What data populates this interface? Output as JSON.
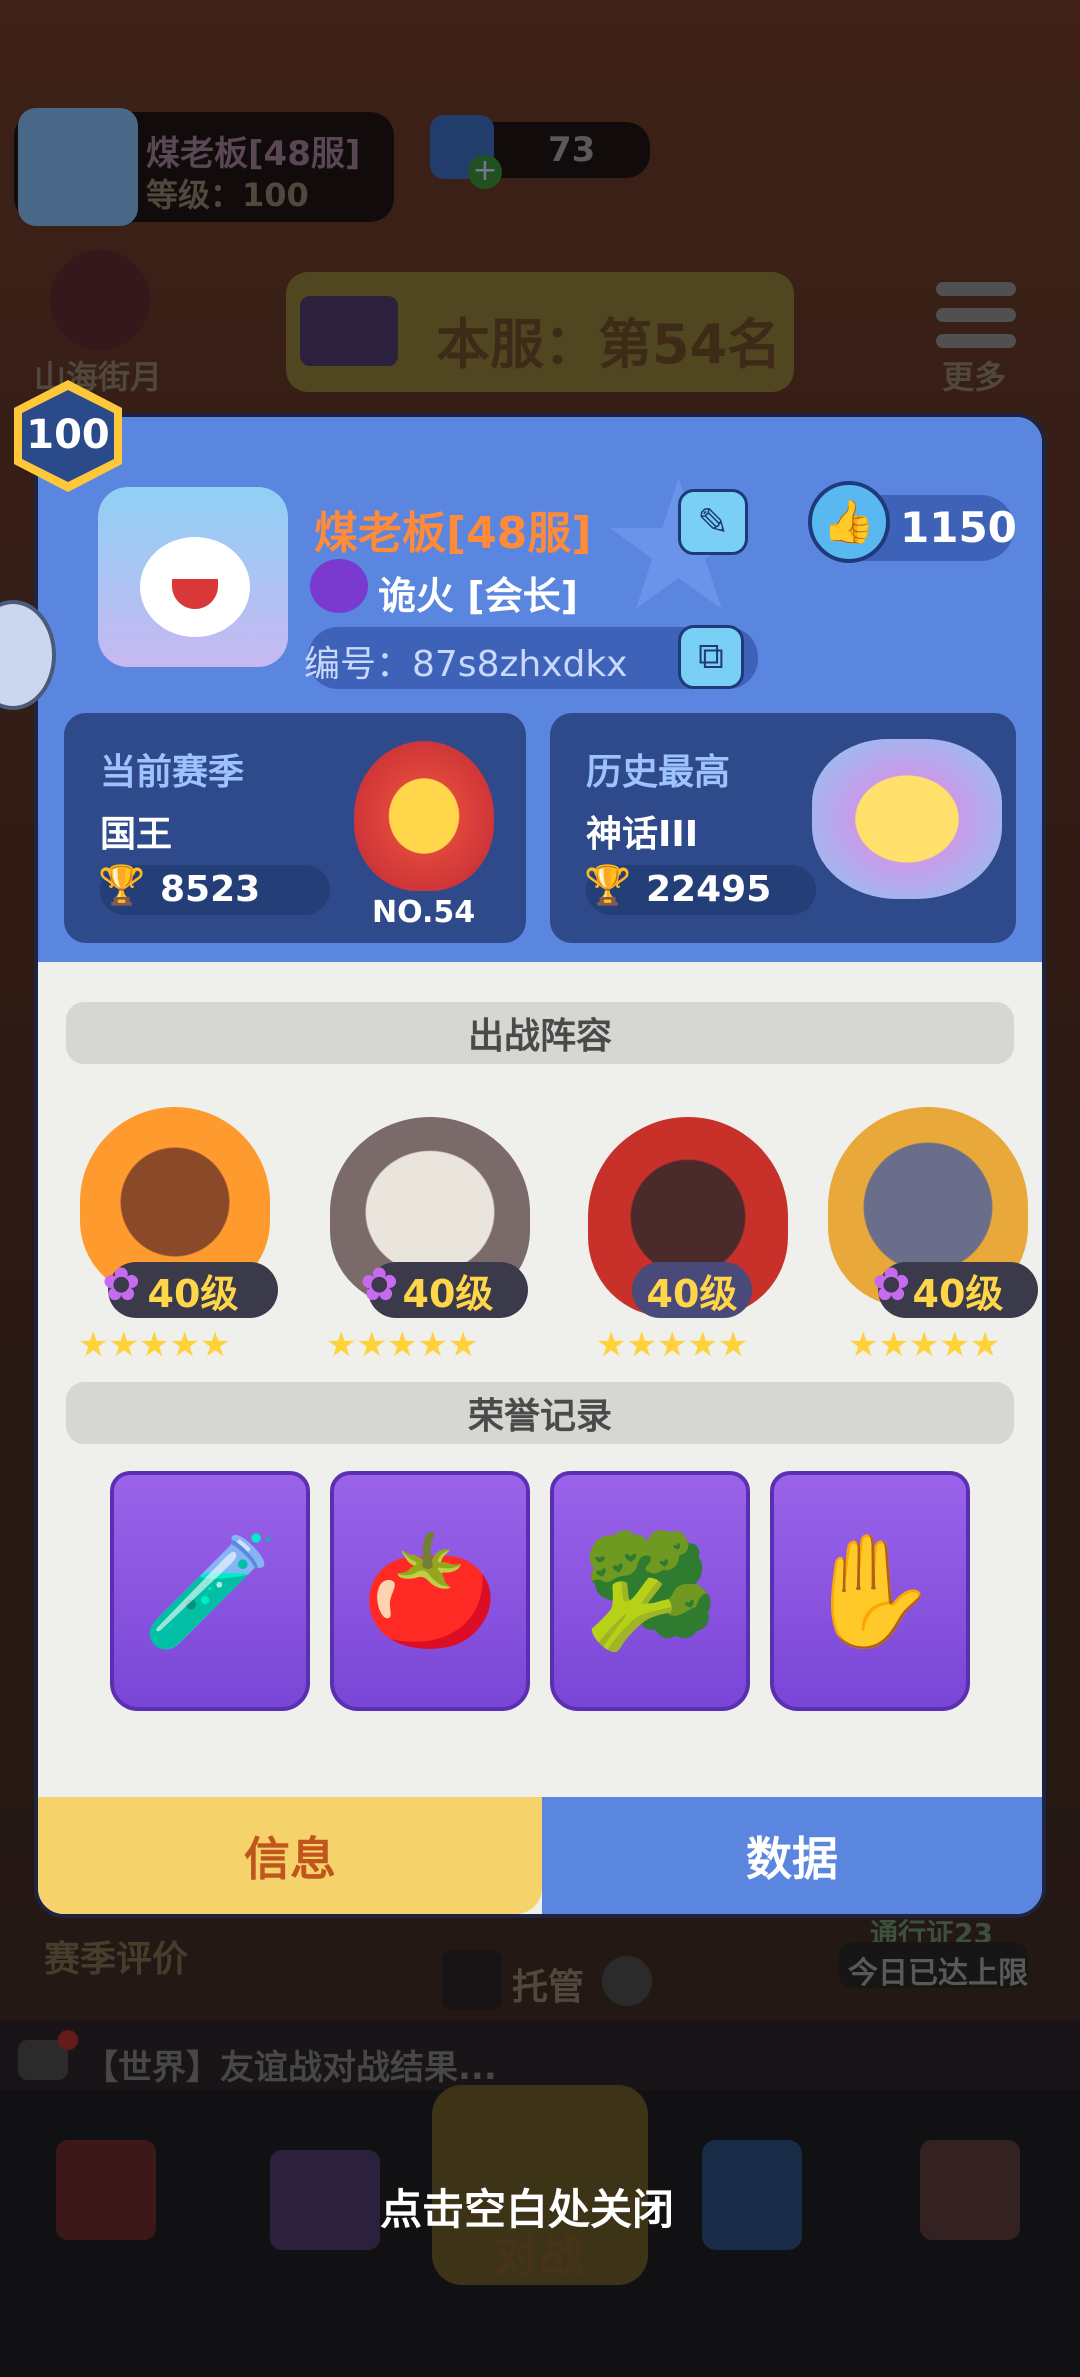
{
  "background": {
    "player_name": "煤老板[48服]",
    "player_level": "等级：100",
    "gem_count": "73",
    "left_menu_label": "山海街月",
    "rank_text": "本服：第54名",
    "more_label": "更多",
    "season_review_label": "赛季评价",
    "auto_label": "托管",
    "pass_label": "通行证23",
    "limit_label": "今日已达上限",
    "chat_text": "【世界】友谊战对战结果...",
    "battle_label": "对战"
  },
  "popup": {
    "level_badge": "100",
    "player_name": "煤老板[48服]",
    "guild": "诡火 [会长]",
    "player_id": "编号：87s8zhxdkx",
    "likes": "1150",
    "current_season": {
      "title": "当前赛季",
      "rank": "国王",
      "trophies": "8523",
      "badge_label": "NO.54"
    },
    "history_best": {
      "title": "历史最高",
      "rank": "神话III",
      "trophies": "22495"
    },
    "lineup_title": "出战阵容",
    "heroes": [
      {
        "level": "40级",
        "stars": "★★★★★",
        "color": "#ff9a2e"
      },
      {
        "level": "40级",
        "stars": "★★★★★",
        "color": "#e9e4dc"
      },
      {
        "level": "40级",
        "stars": "★★★★★",
        "color": "#c8302a"
      },
      {
        "level": "40级",
        "stars": "★★★★★",
        "color": "#5a5e7a"
      }
    ],
    "honor_title": "荣誉记录",
    "honors": [
      "🧪",
      "🍅",
      "🥦",
      "✋"
    ],
    "tab_info": "信息",
    "tab_data": "数据"
  },
  "close_hint": "点击空白处关闭",
  "colors": {
    "accent": "#5a86e0",
    "gold": "#ffd54a",
    "tab_active": "#f6d36a"
  }
}
